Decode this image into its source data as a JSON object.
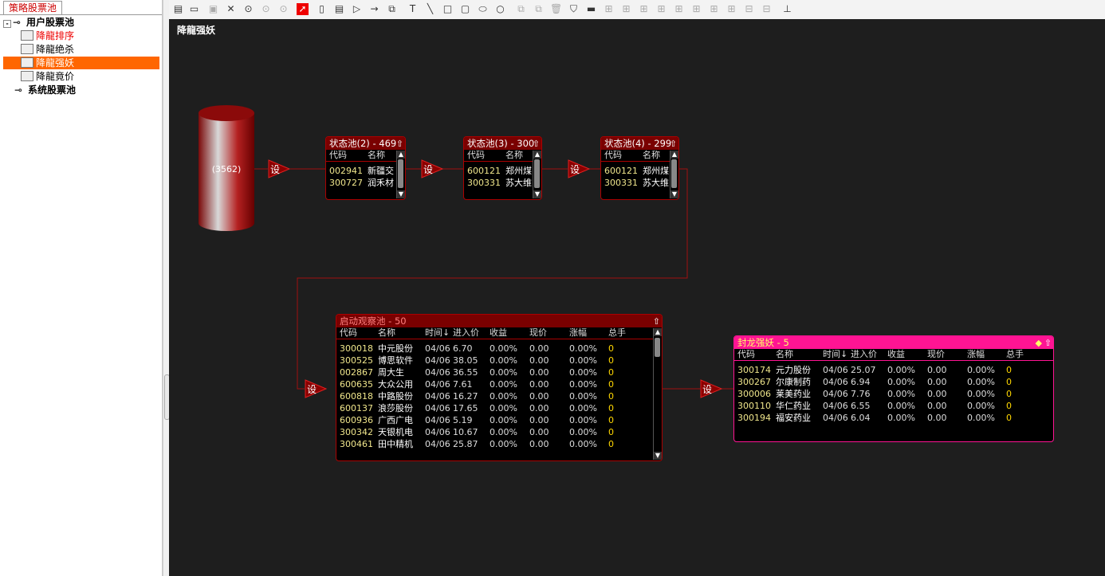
{
  "sidebar": {
    "tab": "策略股票池",
    "groups": [
      {
        "label": "用户股票池",
        "expander": "-"
      },
      {
        "label": "系统股票池"
      }
    ],
    "items": [
      {
        "label": "降龍排序"
      },
      {
        "label": "降龍绝杀"
      },
      {
        "label": "降龍强妖"
      },
      {
        "label": "降龍竟价"
      }
    ]
  },
  "canvas": {
    "title": "降龍强妖",
    "source_count": "(3562)",
    "set_label": "设"
  },
  "state_pools": [
    {
      "title": "状态池(2) - 469",
      "cols": [
        "代码",
        "名称"
      ],
      "rows": [
        [
          "002941",
          "新疆交"
        ],
        [
          "300727",
          "润禾材"
        ]
      ]
    },
    {
      "title": "状态池(3) - 300",
      "cols": [
        "代码",
        "名称"
      ],
      "rows": [
        [
          "600121",
          "郑州煤"
        ],
        [
          "300331",
          "苏大维"
        ]
      ]
    },
    {
      "title": "状态池(4) - 299",
      "cols": [
        "代码",
        "名称"
      ],
      "rows": [
        [
          "600121",
          "郑州煤"
        ],
        [
          "300331",
          "苏大维"
        ]
      ]
    }
  ],
  "watch_pool": {
    "title": "启动观察池 - 50",
    "cols": [
      "代码",
      "名称",
      "时间↓",
      "进入价",
      "收益",
      "现价",
      "涨幅",
      "总手"
    ],
    "rows": [
      [
        "300018",
        "中元股份",
        "04/06",
        "6.70",
        "0.00%",
        "0.00",
        "0.00%",
        "0"
      ],
      [
        "300525",
        "博思软件",
        "04/06",
        "38.05",
        "0.00%",
        "0.00",
        "0.00%",
        "0"
      ],
      [
        "002867",
        "周大生",
        "04/06",
        "36.55",
        "0.00%",
        "0.00",
        "0.00%",
        "0"
      ],
      [
        "600635",
        "大众公用",
        "04/06",
        "7.61",
        "0.00%",
        "0.00",
        "0.00%",
        "0"
      ],
      [
        "600818",
        "中路股份",
        "04/06",
        "16.27",
        "0.00%",
        "0.00",
        "0.00%",
        "0"
      ],
      [
        "600137",
        "浪莎股份",
        "04/06",
        "17.65",
        "0.00%",
        "0.00",
        "0.00%",
        "0"
      ],
      [
        "600936",
        "广西广电",
        "04/06",
        "5.19",
        "0.00%",
        "0.00",
        "0.00%",
        "0"
      ],
      [
        "300342",
        "天银机电",
        "04/06",
        "10.67",
        "0.00%",
        "0.00",
        "0.00%",
        "0"
      ],
      [
        "300461",
        "田中精机",
        "04/06",
        "25.87",
        "0.00%",
        "0.00",
        "0.00%",
        "0"
      ]
    ]
  },
  "final_pool": {
    "title": "封龙强妖 - 5",
    "cols": [
      "代码",
      "名称",
      "时间↓",
      "进入价",
      "收益",
      "现价",
      "涨幅",
      "总手"
    ],
    "rows": [
      [
        "300174",
        "元力股份",
        "04/06",
        "25.07",
        "0.00%",
        "0.00",
        "0.00%",
        "0"
      ],
      [
        "300267",
        "尔康制药",
        "04/06",
        "6.94",
        "0.00%",
        "0.00",
        "0.00%",
        "0"
      ],
      [
        "300006",
        "莱美药业",
        "04/06",
        "7.76",
        "0.00%",
        "0.00",
        "0.00%",
        "0"
      ],
      [
        "300110",
        "华仁药业",
        "04/06",
        "6.55",
        "0.00%",
        "0.00",
        "0.00%",
        "0"
      ],
      [
        "300194",
        "福安药业",
        "04/06",
        "6.04",
        "0.00%",
        "0.00",
        "0.00%",
        "0"
      ]
    ]
  },
  "colors": {
    "accent": "#ff6600",
    "pool_header": "#7a0000",
    "final_header": "#ff1493",
    "code": "#f0e68c",
    "volume": "#ffd700"
  }
}
